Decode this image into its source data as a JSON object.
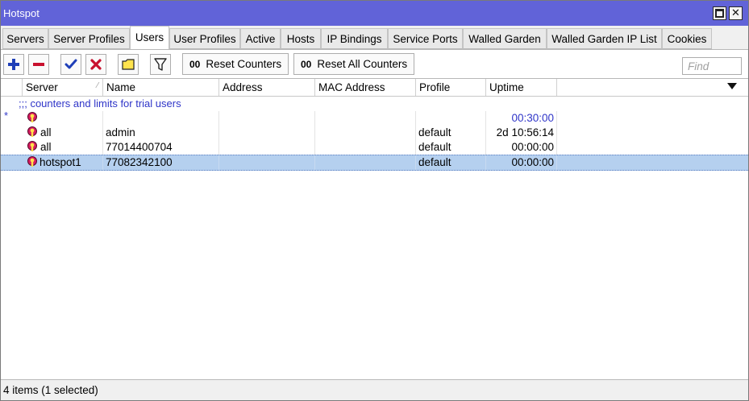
{
  "window": {
    "title": "Hotspot"
  },
  "tabs": [
    {
      "label": "Servers",
      "active": false
    },
    {
      "label": "Server Profiles",
      "active": false
    },
    {
      "label": "Users",
      "active": true
    },
    {
      "label": "User Profiles",
      "active": false
    },
    {
      "label": "Active",
      "active": false
    },
    {
      "label": "Hosts",
      "active": false
    },
    {
      "label": "IP Bindings",
      "active": false
    },
    {
      "label": "Service Ports",
      "active": false
    },
    {
      "label": "Walled Garden",
      "active": false
    },
    {
      "label": "Walled Garden IP List",
      "active": false
    },
    {
      "label": "Cookies",
      "active": false
    }
  ],
  "toolbar": {
    "icons": [
      "add-icon",
      "remove-icon",
      "enable-check-icon",
      "disable-x-icon",
      "comment-note-icon",
      "filter-funnel-icon"
    ],
    "reset_counters": "Reset Counters",
    "reset_all_counters": "Reset All Counters",
    "counter_glyph": "00",
    "find_placeholder": "Find"
  },
  "table": {
    "columns": [
      "Server",
      "Name",
      "Address",
      "MAC Address",
      "Profile",
      "Uptime"
    ],
    "comment": ";;; counters and limits for trial users",
    "rows": [
      {
        "marker": "*",
        "server": "",
        "name": "",
        "address": "",
        "mac": "",
        "profile": "",
        "uptime": "00:30:00"
      },
      {
        "marker": "",
        "server": "all",
        "name": "admin",
        "address": "",
        "mac": "",
        "profile": "default",
        "uptime": "2d 10:56:14"
      },
      {
        "marker": "",
        "server": "all",
        "name": "77014400704",
        "address": "",
        "mac": "",
        "profile": "default",
        "uptime": "00:00:00"
      },
      {
        "marker": "",
        "server": "hotspot1",
        "name": "77082342100",
        "address": "",
        "mac": "",
        "profile": "default",
        "uptime": "00:00:00",
        "selected": true
      }
    ]
  },
  "status": {
    "text": "4 items (1 selected)"
  },
  "colors": {
    "titlebar": "#6163d8",
    "selection": "#b5d0ef",
    "comment": "#2f35c8"
  }
}
